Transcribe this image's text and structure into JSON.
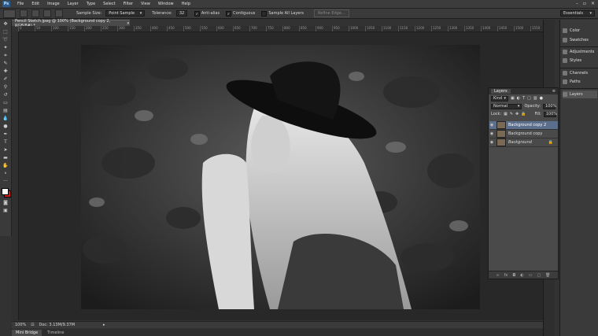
{
  "menubar": {
    "logo": "Ps",
    "items": [
      "File",
      "Edit",
      "Image",
      "Layer",
      "Type",
      "Select",
      "Filter",
      "View",
      "Window",
      "Help"
    ]
  },
  "options": {
    "sample_size_label": "Sample Size:",
    "sample_size_value": "Point Sample",
    "tolerance_label": "Tolerance:",
    "tolerance_value": "32",
    "antialias_label": "Anti-alias",
    "contiguous_label": "Contiguous",
    "sample_all_label": "Sample All Layers",
    "refine_edge_label": "Refine Edge...",
    "workspace": "Essentials"
  },
  "document": {
    "tab_title": "Pencil Sketch.jpeg @ 100% (Background copy 2, RGB/8#) *",
    "close_glyph": "×"
  },
  "ruler_ticks": [
    "0",
    "50",
    "100",
    "150",
    "200",
    "250",
    "300",
    "350",
    "400",
    "450",
    "500",
    "550",
    "600",
    "650",
    "700",
    "750",
    "800",
    "850",
    "900",
    "950",
    "1000",
    "1050",
    "1100",
    "1150",
    "1200",
    "1250",
    "1300",
    "1350",
    "1400",
    "1450",
    "1500",
    "1550"
  ],
  "status": {
    "zoom": "100%",
    "doc": "Doc: 3.13M/9.37M"
  },
  "bottom_tabs": [
    "Mini Bridge",
    "Timeline"
  ],
  "dock": {
    "items": [
      {
        "label": "Color",
        "icon": "color-icon"
      },
      {
        "label": "Swatches",
        "icon": "swatches-icon"
      },
      {
        "label": "Adjustments",
        "icon": "adjustments-icon"
      },
      {
        "label": "Styles",
        "icon": "styles-icon"
      },
      {
        "label": "Channels",
        "icon": "channels-icon"
      },
      {
        "label": "Paths",
        "icon": "paths-icon"
      },
      {
        "label": "Layers",
        "icon": "layers-icon"
      }
    ]
  },
  "layers_panel": {
    "title": "Layers",
    "kind": "Kind",
    "blend_mode": "Normal",
    "opacity_label": "Opacity:",
    "opacity_value": "100%",
    "lock_label": "Lock:",
    "fill_label": "Fill:",
    "fill_value": "100%",
    "layers": [
      {
        "name": "Background copy 2",
        "selected": true
      },
      {
        "name": "Background copy",
        "selected": false
      },
      {
        "name": "Background",
        "selected": false,
        "locked": true
      }
    ],
    "footer_icons": [
      "link-icon",
      "fx-icon",
      "mask-icon",
      "adjustment-layer-icon",
      "group-icon",
      "new-layer-icon",
      "trash-icon"
    ]
  },
  "colors": {
    "selected_layer": "#5b6f8c",
    "foreground": "#ffffff",
    "background": "#c81e1e"
  }
}
